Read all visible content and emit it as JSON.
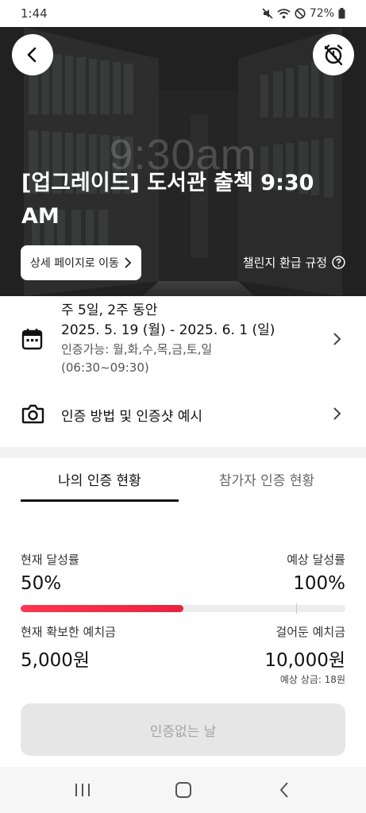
{
  "status_bar": {
    "time": "1:44",
    "battery": "72%",
    "icons": [
      "mute-icon",
      "wifi-icon",
      "dnd-icon",
      "battery-icon"
    ]
  },
  "hero": {
    "background_text": "9:30am",
    "title": "[업그레이드] 도서관 출첵 9:30 AM",
    "detail_button": "상세 페이지로 이동",
    "refund_link": "챌린지 환급 규정"
  },
  "period": {
    "title": "주 5일, 2주 동안",
    "range": "2025. 5. 19 (월) - 2025. 6. 1 (일)",
    "days": "인증가능: 월,화,수,목,금,토,일",
    "hours": "(06:30~09:30)"
  },
  "method": {
    "label": "인증 방법 및 인증샷 예시"
  },
  "tabs": {
    "mine": "나의 인증 현황",
    "others": "참가자 인증 현황"
  },
  "progress": {
    "current_label": "현재 달성률",
    "current_value": "50%",
    "expected_label": "예상 달성률",
    "expected_value": "100%",
    "fill_fraction": 0.5
  },
  "deposit": {
    "secured_label": "현재 확보한 예치금",
    "secured_value": "5,000원",
    "staked_label": "걸어둔 예치금",
    "staked_value": "10,000원",
    "reward_note": "예상 상금: 18원"
  },
  "no_cert_button": "인증없는 날",
  "colors": {
    "accent": "#ee2a45",
    "disabled_bg": "#e6e6e6"
  }
}
